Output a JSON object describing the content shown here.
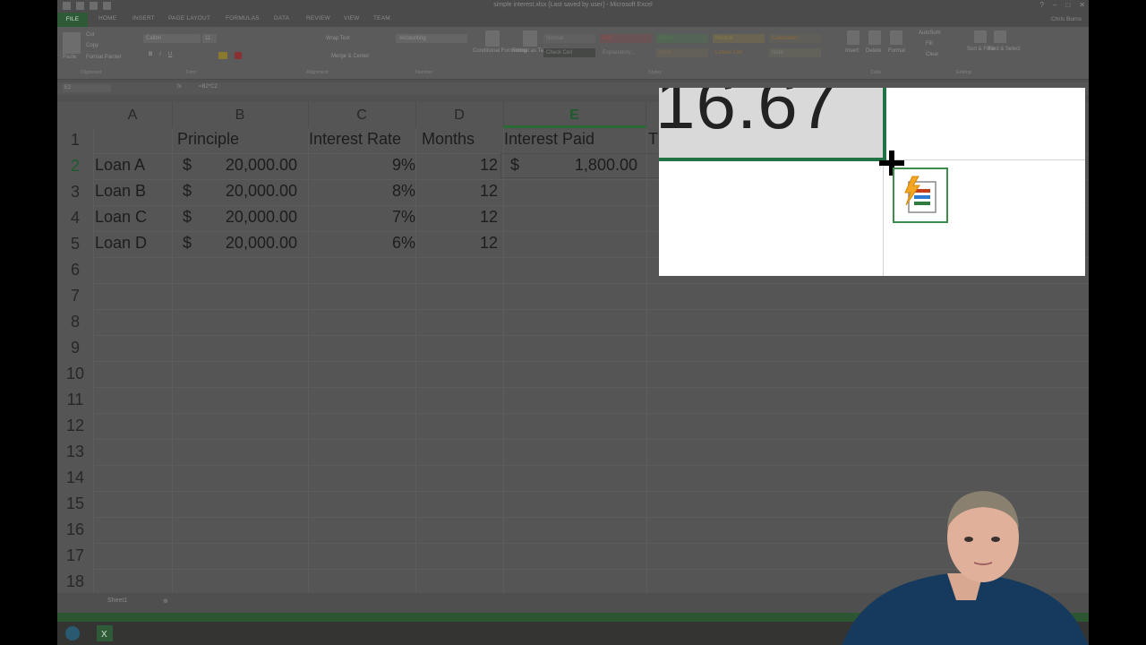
{
  "window": {
    "title": "simple interest.xlsx [Last saved by user] - Microsoft Excel",
    "user": "Chris Burns"
  },
  "ribbon": {
    "tabs": [
      "FILE",
      "HOME",
      "INSERT",
      "PAGE LAYOUT",
      "FORMULAS",
      "DATA",
      "REVIEW",
      "VIEW",
      "TEAM"
    ],
    "clipboard": {
      "paste": "Paste",
      "cut": "Cut",
      "copy": "Copy",
      "format_painter": "Format Painter",
      "group": "Clipboard"
    },
    "font": {
      "name": "Calibri",
      "size": "11",
      "group": "Font"
    },
    "alignment": {
      "wrap": "Wrap Text",
      "merge": "Merge & Center",
      "group": "Alignment"
    },
    "number": {
      "format": "Accounting",
      "group": "Number"
    },
    "styles": {
      "conditional": "Conditional Formatting",
      "format_table": "Format as Table",
      "items": [
        "Normal",
        "Bad",
        "Good",
        "Neutral",
        "Calculation",
        "Check Cell",
        "Explanatory...",
        "Input",
        "Linked Cell",
        "Note"
      ],
      "group": "Styles"
    },
    "cells": {
      "insert": "Insert",
      "delete": "Delete",
      "format": "Format",
      "group": "Cells"
    },
    "editing": {
      "autosum": "AutoSum",
      "fill": "Fill",
      "clear": "Clear",
      "sort": "Sort & Filter",
      "find": "Find & Select",
      "group": "Editing"
    }
  },
  "formula_bar": {
    "name_box": "E2",
    "fx": "fx",
    "formula": "=B2*C2"
  },
  "sheet": {
    "columns": [
      "A",
      "B",
      "C",
      "D",
      "E",
      "T"
    ],
    "rows": [
      "1",
      "2",
      "3",
      "4",
      "5",
      "6",
      "7",
      "8",
      "9",
      "10",
      "11",
      "12",
      "13",
      "14",
      "15",
      "16",
      "17",
      "18"
    ],
    "header_row": {
      "principle": "Principle",
      "rate": "Interest Rate",
      "months": "Months",
      "paid": "Interest Paid",
      "total": "T"
    },
    "loans": [
      {
        "name": "Loan A",
        "cur": "$",
        "principle": "20,000.00",
        "rate": "9%",
        "months": "12"
      },
      {
        "name": "Loan B",
        "cur": "$",
        "principle": "20,000.00",
        "rate": "8%",
        "months": "12"
      },
      {
        "name": "Loan C",
        "cur": "$",
        "principle": "20,000.00",
        "rate": "7%",
        "months": "12"
      },
      {
        "name": "Loan D",
        "cur": "$",
        "principle": "20,000.00",
        "rate": "6%",
        "months": "12"
      }
    ],
    "interest_paid_row2": {
      "cur": "$",
      "value": "1,800.00"
    },
    "tab_name": "Sheet1"
  },
  "zoom": {
    "value": "16.67"
  },
  "colors": {
    "excel_green": "#217346",
    "selection_gray": "#d9d9d9"
  },
  "icons": [
    "quick-access-save-icon",
    "undo-icon",
    "redo-icon",
    "flash-fill-icon",
    "crosshair-cursor-icon",
    "excel-taskbar-icon"
  ]
}
